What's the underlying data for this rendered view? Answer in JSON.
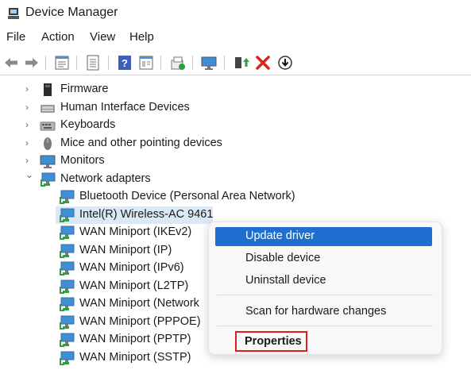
{
  "window": {
    "title": "Device Manager"
  },
  "menu": [
    "File",
    "Action",
    "View",
    "Help"
  ],
  "toolbar_icons": [
    "back-arrow-icon",
    "forward-arrow-icon",
    "properties-sheet-icon",
    "device-list-icon",
    "help-icon",
    "console-view-icon",
    "scan-hardware-icon",
    "monitor-icon",
    "update-driver-icon",
    "uninstall-x-icon",
    "disable-device-icon"
  ],
  "tree": [
    {
      "label": "Firmware",
      "expanded": false,
      "level": 0
    },
    {
      "label": "Human Interface Devices",
      "expanded": false,
      "level": 0
    },
    {
      "label": "Keyboards",
      "expanded": false,
      "level": 0
    },
    {
      "label": "Mice and other pointing devices",
      "expanded": false,
      "level": 0
    },
    {
      "label": "Monitors",
      "expanded": false,
      "level": 0
    },
    {
      "label": "Network adapters",
      "expanded": true,
      "level": 0
    },
    {
      "label": "Bluetooth Device (Personal Area Network)",
      "level": 1
    },
    {
      "label": "Intel(R) Wireless-AC 9461",
      "level": 1,
      "selected": true
    },
    {
      "label": "WAN Miniport (IKEv2)",
      "level": 1
    },
    {
      "label": "WAN Miniport (IP)",
      "level": 1
    },
    {
      "label": "WAN Miniport (IPv6)",
      "level": 1
    },
    {
      "label": "WAN Miniport (L2TP)",
      "level": 1
    },
    {
      "label": "WAN Miniport (Network",
      "level": 1
    },
    {
      "label": "WAN Miniport (PPPOE)",
      "level": 1
    },
    {
      "label": "WAN Miniport (PPTP)",
      "level": 1
    },
    {
      "label": "WAN Miniport (SSTP)",
      "level": 1
    }
  ],
  "context_menu": {
    "update_driver": "Update driver",
    "disable_device": "Disable device",
    "uninstall_device": "Uninstall device",
    "scan": "Scan for hardware changes",
    "properties": "Properties"
  },
  "colors": {
    "highlight": "#1f6fd0",
    "selection": "#dbe9f7",
    "annotation": "#e21b1b"
  }
}
